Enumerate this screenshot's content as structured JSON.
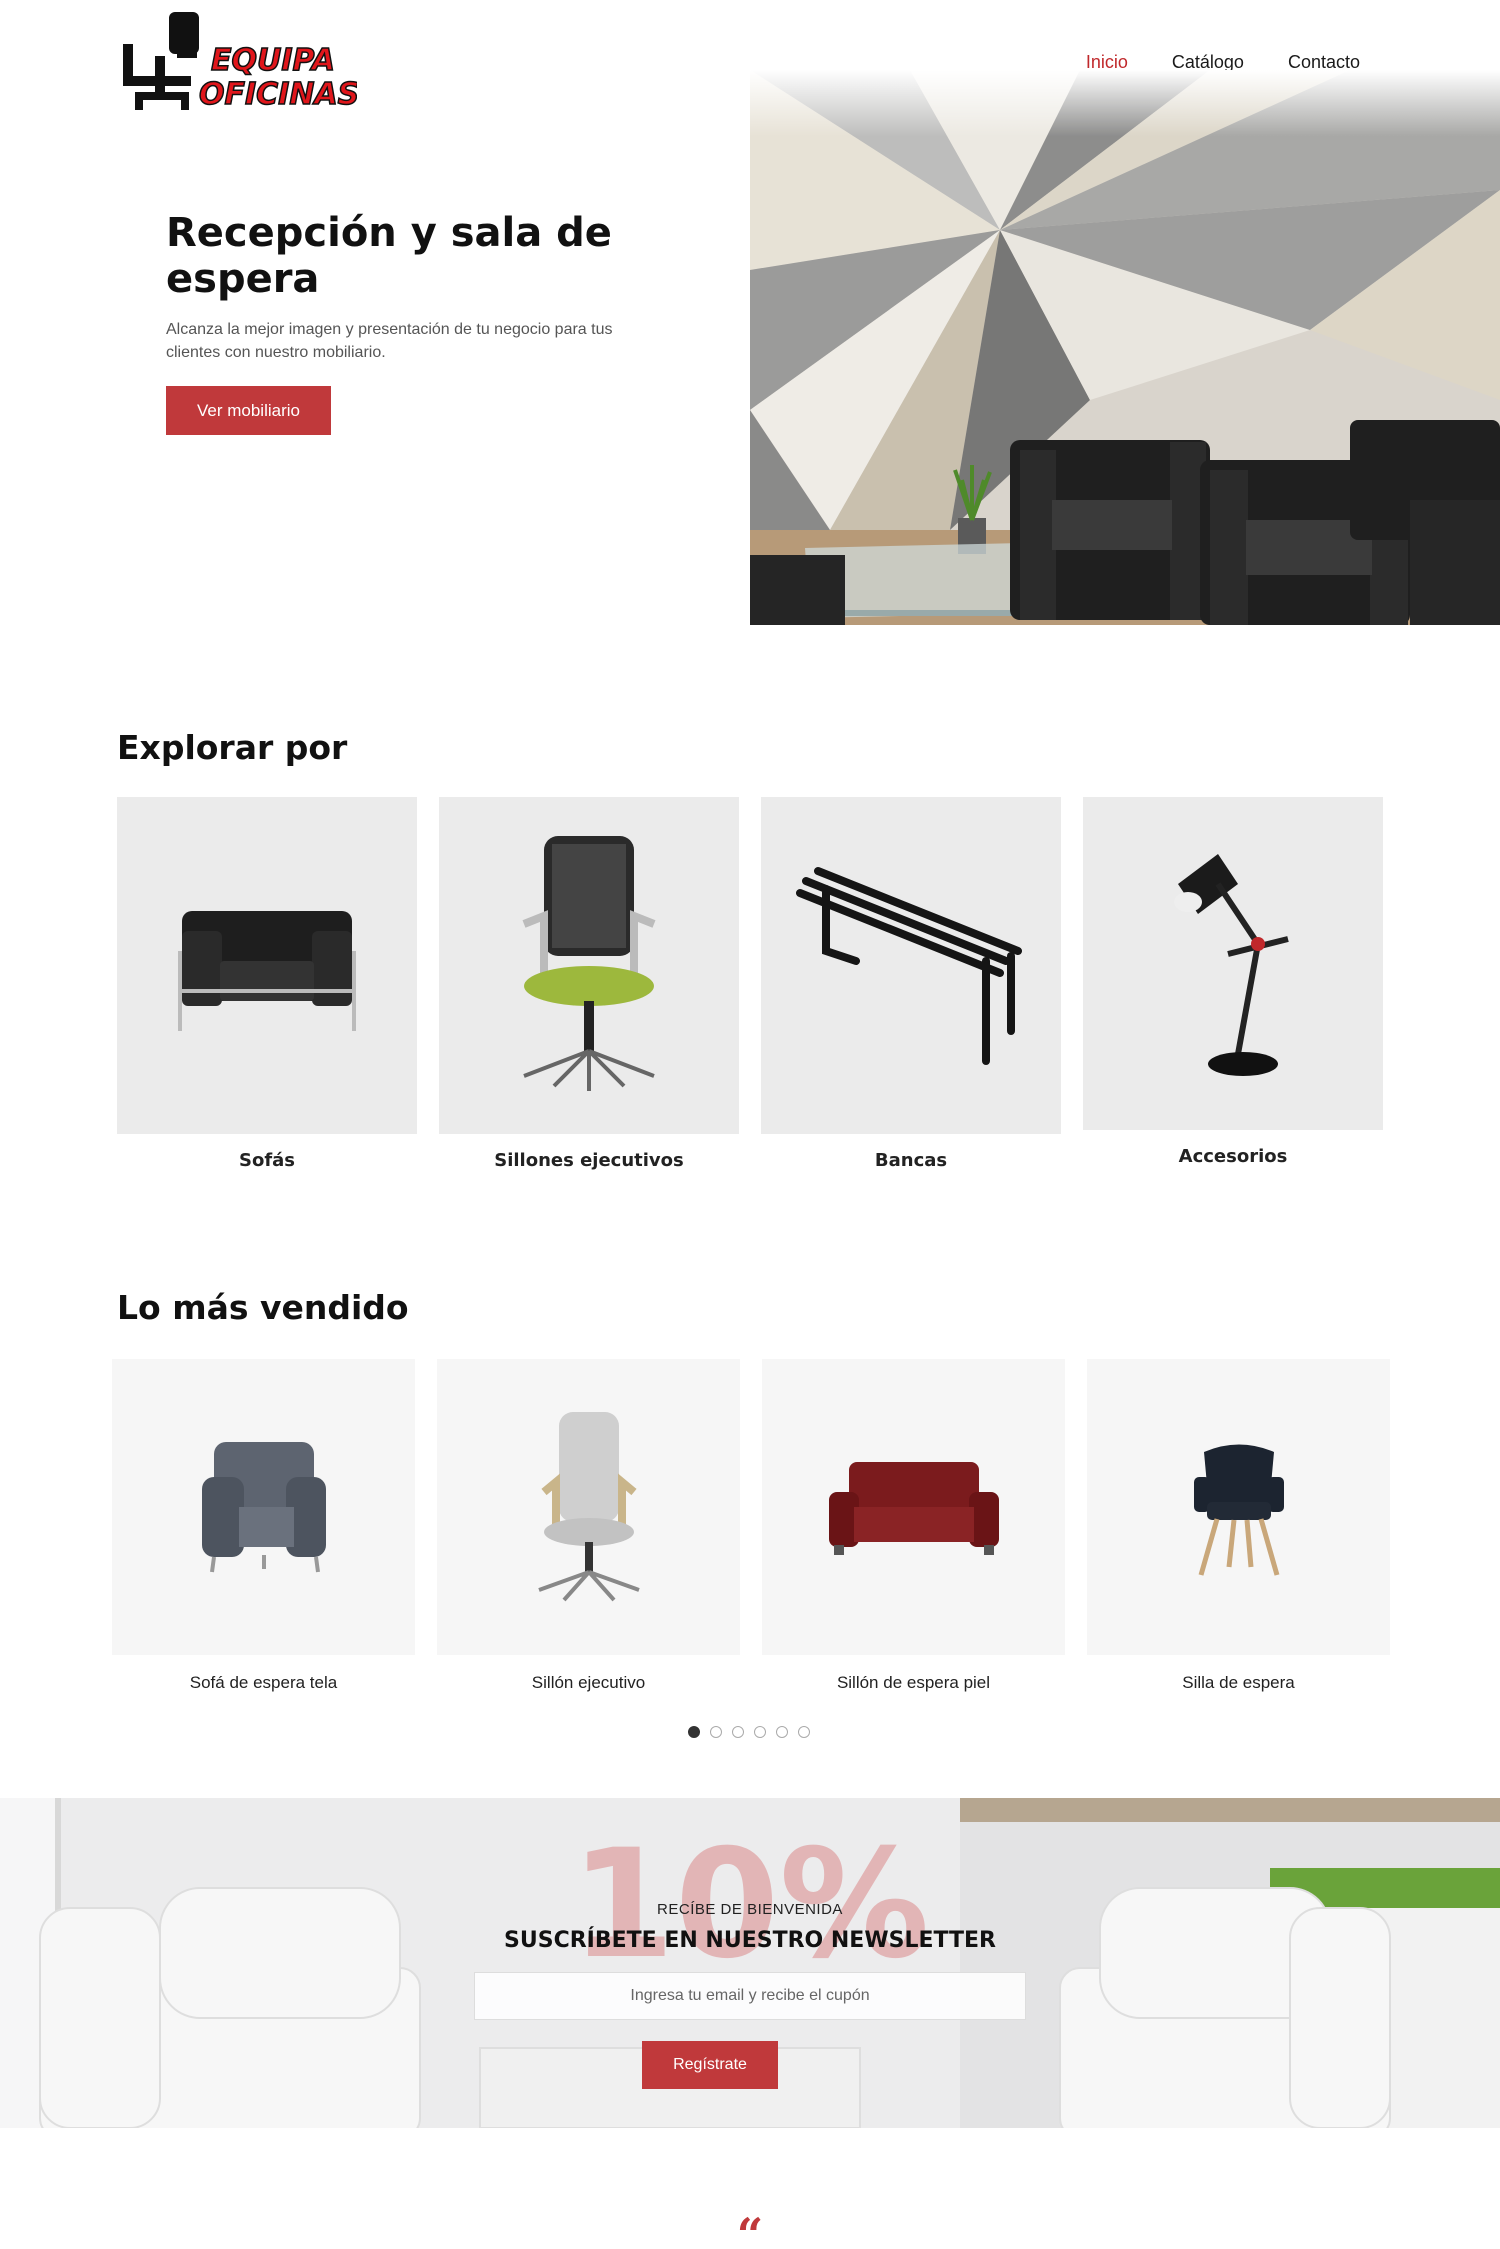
{
  "brand": {
    "line1": "EQUIPA",
    "line2": "OFICINAS",
    "accent": "#e0161b"
  },
  "nav": [
    {
      "label": "Inicio"
    },
    {
      "label": "Catálogo"
    },
    {
      "label": "Contacto"
    }
  ],
  "hero": {
    "title": "Recepción y sala de espera",
    "subtitle": "Alcanza la mejor imagen y presentación de tu negocio para tus clientes con nuestro mobiliario.",
    "button": "Ver mobiliario",
    "image_icon": "lobby-armchairs-image"
  },
  "explore": {
    "title": "Explorar por",
    "items": [
      {
        "label": "Sofás",
        "icon": "armchair-icon"
      },
      {
        "label": "Sillones ejecutivos",
        "icon": "office-chair-icon"
      },
      {
        "label": "Bancas",
        "icon": "bench-icon"
      },
      {
        "label": "Accesorios",
        "icon": "desk-lamp-icon"
      }
    ]
  },
  "bestsellers": {
    "title": "Lo más vendido",
    "items": [
      {
        "label": "Sofá de espera tela",
        "icon": "fabric-armchair-icon"
      },
      {
        "label": "Sillón ejecutivo",
        "icon": "executive-chair-icon"
      },
      {
        "label": "Sillón de espera piel",
        "icon": "leather-loveseat-icon"
      },
      {
        "label": "Silla de espera",
        "icon": "wood-leg-chair-icon"
      }
    ],
    "carousel_pages": 6,
    "carousel_active": 1
  },
  "newsletter": {
    "big": "10%",
    "kicker": "RECÍBE DE BIENVENIDA",
    "title": "SUSCRÍBETE EN NUESTRO NEWSLETTER",
    "placeholder": "Ingresa tu email y recibe el cupón",
    "button": "Regístrate"
  },
  "testimonial": {
    "quote_mark": "“"
  },
  "colors": {
    "accent": "#c0393b",
    "card_bg": "#ebebeb"
  }
}
